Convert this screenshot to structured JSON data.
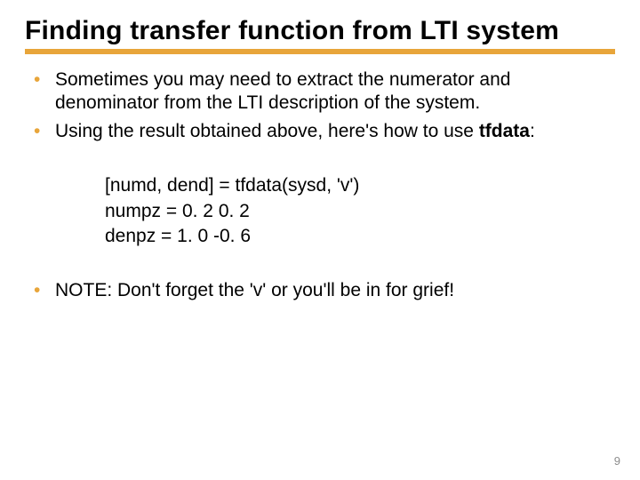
{
  "title": "Finding transfer function from LTI system",
  "bullets": {
    "b1": "Sometimes you may need to extract the numerator and denominator from the LTI description of the system.",
    "b2_prefix": "Using the result obtained above, here's how to use ",
    "b2_bold": "tfdata",
    "b2_suffix": ":"
  },
  "code": {
    "l1": "[numd, dend] = tfdata(sysd, 'v')",
    "l2": "numpz = 0. 2 0. 2",
    "l3": "denpz =  1. 0 -0. 6"
  },
  "note": "NOTE: Don't forget the 'v' or you'll be in for grief!",
  "page": "9"
}
